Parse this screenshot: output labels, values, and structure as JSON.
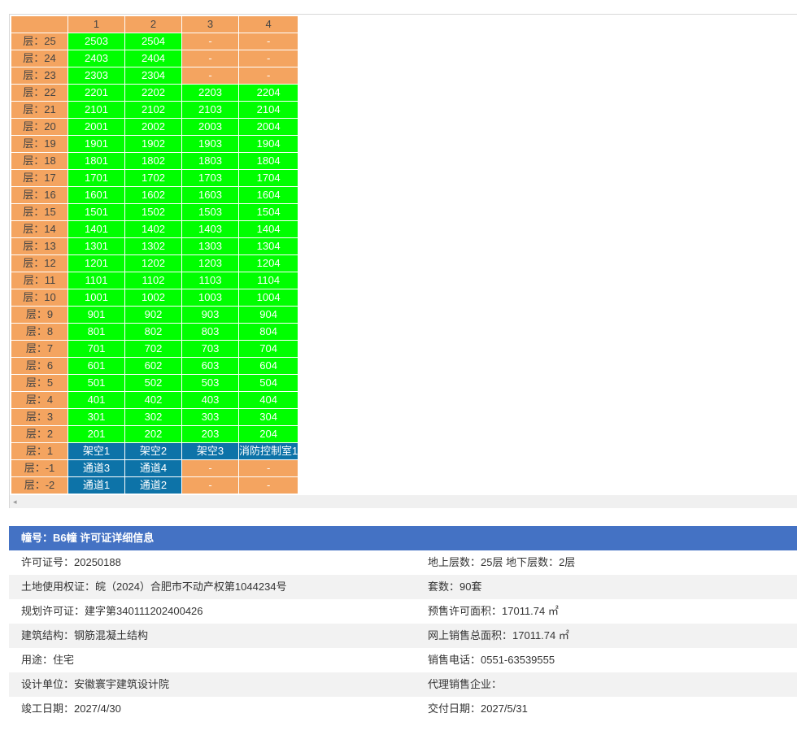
{
  "columns": [
    "",
    "1",
    "2",
    "3",
    "4"
  ],
  "floors": [
    {
      "label": "层：25",
      "units": [
        {
          "t": "2503",
          "s": "g"
        },
        {
          "t": "2504",
          "s": "g"
        },
        {
          "t": "-",
          "s": "o"
        },
        {
          "t": "-",
          "s": "o"
        }
      ]
    },
    {
      "label": "层：24",
      "units": [
        {
          "t": "2403",
          "s": "g"
        },
        {
          "t": "2404",
          "s": "g"
        },
        {
          "t": "-",
          "s": "o"
        },
        {
          "t": "-",
          "s": "o"
        }
      ]
    },
    {
      "label": "层：23",
      "units": [
        {
          "t": "2303",
          "s": "g"
        },
        {
          "t": "2304",
          "s": "g"
        },
        {
          "t": "-",
          "s": "o"
        },
        {
          "t": "-",
          "s": "o"
        }
      ]
    },
    {
      "label": "层：22",
      "units": [
        {
          "t": "2201",
          "s": "g"
        },
        {
          "t": "2202",
          "s": "g"
        },
        {
          "t": "2203",
          "s": "g"
        },
        {
          "t": "2204",
          "s": "g"
        }
      ]
    },
    {
      "label": "层：21",
      "units": [
        {
          "t": "2101",
          "s": "g"
        },
        {
          "t": "2102",
          "s": "g"
        },
        {
          "t": "2103",
          "s": "g"
        },
        {
          "t": "2104",
          "s": "g"
        }
      ]
    },
    {
      "label": "层：20",
      "units": [
        {
          "t": "2001",
          "s": "g"
        },
        {
          "t": "2002",
          "s": "g"
        },
        {
          "t": "2003",
          "s": "g"
        },
        {
          "t": "2004",
          "s": "g"
        }
      ]
    },
    {
      "label": "层：19",
      "units": [
        {
          "t": "1901",
          "s": "g"
        },
        {
          "t": "1902",
          "s": "g"
        },
        {
          "t": "1903",
          "s": "g"
        },
        {
          "t": "1904",
          "s": "g"
        }
      ]
    },
    {
      "label": "层：18",
      "units": [
        {
          "t": "1801",
          "s": "g"
        },
        {
          "t": "1802",
          "s": "g"
        },
        {
          "t": "1803",
          "s": "g"
        },
        {
          "t": "1804",
          "s": "g"
        }
      ]
    },
    {
      "label": "层：17",
      "units": [
        {
          "t": "1701",
          "s": "g"
        },
        {
          "t": "1702",
          "s": "g"
        },
        {
          "t": "1703",
          "s": "g"
        },
        {
          "t": "1704",
          "s": "g"
        }
      ]
    },
    {
      "label": "层：16",
      "units": [
        {
          "t": "1601",
          "s": "g"
        },
        {
          "t": "1602",
          "s": "g"
        },
        {
          "t": "1603",
          "s": "g"
        },
        {
          "t": "1604",
          "s": "g"
        }
      ]
    },
    {
      "label": "层：15",
      "units": [
        {
          "t": "1501",
          "s": "g"
        },
        {
          "t": "1502",
          "s": "g"
        },
        {
          "t": "1503",
          "s": "g"
        },
        {
          "t": "1504",
          "s": "g"
        }
      ]
    },
    {
      "label": "层：14",
      "units": [
        {
          "t": "1401",
          "s": "g"
        },
        {
          "t": "1402",
          "s": "g"
        },
        {
          "t": "1403",
          "s": "g"
        },
        {
          "t": "1404",
          "s": "g"
        }
      ]
    },
    {
      "label": "层：13",
      "units": [
        {
          "t": "1301",
          "s": "g"
        },
        {
          "t": "1302",
          "s": "g"
        },
        {
          "t": "1303",
          "s": "g"
        },
        {
          "t": "1304",
          "s": "g"
        }
      ]
    },
    {
      "label": "层：12",
      "units": [
        {
          "t": "1201",
          "s": "g"
        },
        {
          "t": "1202",
          "s": "g"
        },
        {
          "t": "1203",
          "s": "g"
        },
        {
          "t": "1204",
          "s": "g"
        }
      ]
    },
    {
      "label": "层：11",
      "units": [
        {
          "t": "1101",
          "s": "g"
        },
        {
          "t": "1102",
          "s": "g"
        },
        {
          "t": "1103",
          "s": "g"
        },
        {
          "t": "1104",
          "s": "g"
        }
      ]
    },
    {
      "label": "层：10",
      "units": [
        {
          "t": "1001",
          "s": "g"
        },
        {
          "t": "1002",
          "s": "g"
        },
        {
          "t": "1003",
          "s": "g"
        },
        {
          "t": "1004",
          "s": "g"
        }
      ]
    },
    {
      "label": "层：9",
      "units": [
        {
          "t": "901",
          "s": "g"
        },
        {
          "t": "902",
          "s": "g"
        },
        {
          "t": "903",
          "s": "g"
        },
        {
          "t": "904",
          "s": "g"
        }
      ]
    },
    {
      "label": "层：8",
      "units": [
        {
          "t": "801",
          "s": "g"
        },
        {
          "t": "802",
          "s": "g"
        },
        {
          "t": "803",
          "s": "g"
        },
        {
          "t": "804",
          "s": "g"
        }
      ]
    },
    {
      "label": "层：7",
      "units": [
        {
          "t": "701",
          "s": "g"
        },
        {
          "t": "702",
          "s": "g"
        },
        {
          "t": "703",
          "s": "g"
        },
        {
          "t": "704",
          "s": "g"
        }
      ]
    },
    {
      "label": "层：6",
      "units": [
        {
          "t": "601",
          "s": "g"
        },
        {
          "t": "602",
          "s": "g"
        },
        {
          "t": "603",
          "s": "g"
        },
        {
          "t": "604",
          "s": "g"
        }
      ]
    },
    {
      "label": "层：5",
      "units": [
        {
          "t": "501",
          "s": "g"
        },
        {
          "t": "502",
          "s": "g"
        },
        {
          "t": "503",
          "s": "g"
        },
        {
          "t": "504",
          "s": "g"
        }
      ]
    },
    {
      "label": "层：4",
      "units": [
        {
          "t": "401",
          "s": "g"
        },
        {
          "t": "402",
          "s": "g"
        },
        {
          "t": "403",
          "s": "g"
        },
        {
          "t": "404",
          "s": "g"
        }
      ]
    },
    {
      "label": "层：3",
      "units": [
        {
          "t": "301",
          "s": "g"
        },
        {
          "t": "302",
          "s": "g"
        },
        {
          "t": "303",
          "s": "g"
        },
        {
          "t": "304",
          "s": "g"
        }
      ]
    },
    {
      "label": "层：2",
      "units": [
        {
          "t": "201",
          "s": "g"
        },
        {
          "t": "202",
          "s": "g"
        },
        {
          "t": "203",
          "s": "g"
        },
        {
          "t": "204",
          "s": "g"
        }
      ]
    },
    {
      "label": "层：1",
      "units": [
        {
          "t": "架空1",
          "s": "b"
        },
        {
          "t": "架空2",
          "s": "b"
        },
        {
          "t": "架空3",
          "s": "b"
        },
        {
          "t": "消防控制室1",
          "s": "b"
        }
      ]
    },
    {
      "label": "层：-1",
      "units": [
        {
          "t": "通道3",
          "s": "b"
        },
        {
          "t": "通道4",
          "s": "b"
        },
        {
          "t": "-",
          "s": "o"
        },
        {
          "t": "-",
          "s": "o"
        }
      ]
    },
    {
      "label": "层：-2",
      "units": [
        {
          "t": "通道1",
          "s": "b"
        },
        {
          "t": "通道2",
          "s": "b"
        },
        {
          "t": "-",
          "s": "o"
        },
        {
          "t": "-",
          "s": "o"
        }
      ]
    }
  ],
  "status_colors": {
    "g": "#00ff00",
    "b": "#0d73a8",
    "o": "#f4a460"
  },
  "scroll_left_icon": "◂",
  "info": {
    "title": "幢号：B6幢 许可证详细信息",
    "rows": [
      {
        "left": "许可证号：20250188",
        "right": "地上层数：25层  地下层数：2层"
      },
      {
        "left": "土地使用权证：皖（2024）合肥市不动产权第1044234号",
        "right": "套数：90套"
      },
      {
        "left": "规划许可证：建字第340111202400426",
        "right": "预售许可面积：17011.74 ㎡"
      },
      {
        "left": "建筑结构：钢筋混凝土结构",
        "right": "网上销售总面积：17011.74 ㎡"
      },
      {
        "left": "用途：住宅",
        "right": "销售电话：0551-63539555"
      },
      {
        "left": "设计单位：安徽寰宇建筑设计院",
        "right": "代理销售企业："
      },
      {
        "left": "竣工日期：2027/4/30",
        "right": "交付日期：2027/5/31"
      }
    ]
  }
}
